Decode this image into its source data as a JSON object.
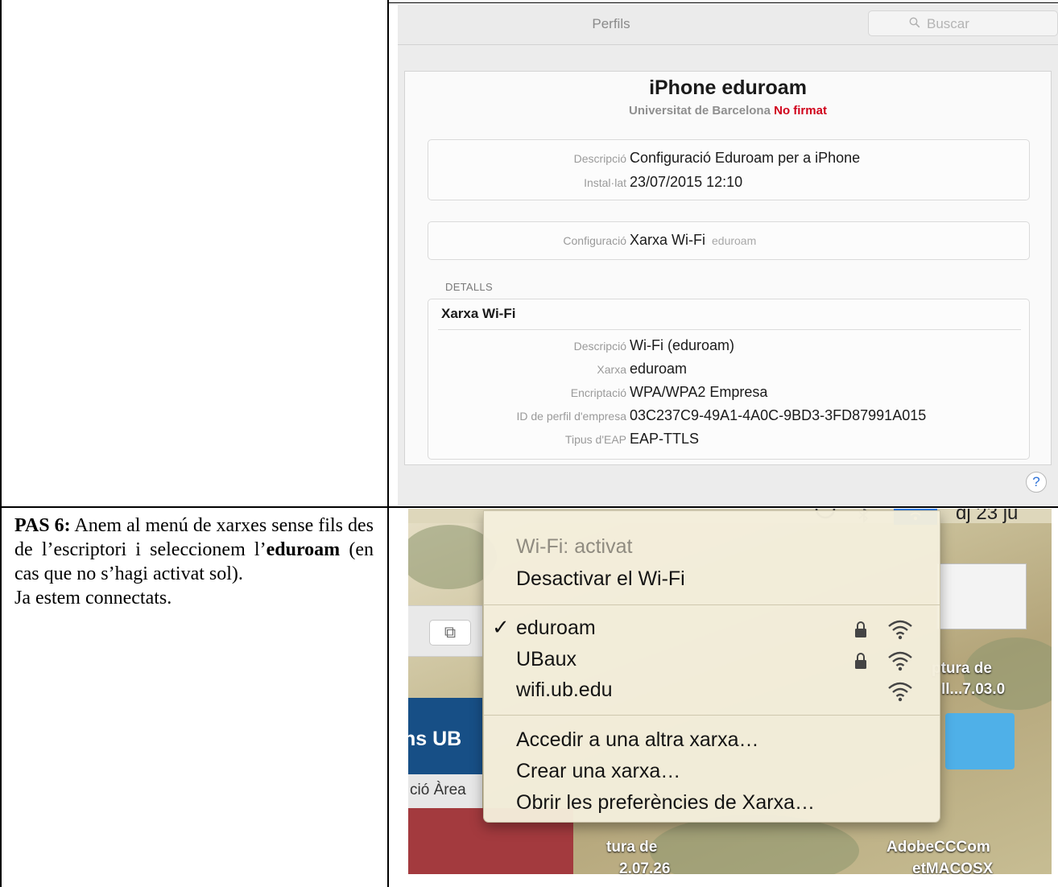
{
  "step": {
    "label": "PAS 6:",
    "text_before": " Anem al menú de xarxes sense fils des de l’escriptori i seleccionem l’",
    "highlight": "eduroam",
    "text_after": " (en cas que no s’hagi activat sol).",
    "line2": "Ja estem connectats."
  },
  "profiles_window": {
    "title": "Perfils",
    "search_placeholder": "Buscar",
    "profile_name": "iPhone eduroam",
    "organization": "Universitat de Barcelona",
    "signed_status": "No firmat",
    "summary": [
      {
        "key": "Descripció",
        "value": "Configuració Eduroam per a iPhone"
      },
      {
        "key": "Instal·lat",
        "value": "23/07/2015 12:10"
      }
    ],
    "configuration": {
      "key": "Configuració",
      "value": "Xarxa Wi-Fi",
      "extra": "eduroam"
    },
    "details_label": "DETALLS",
    "details_title": "Xarxa Wi-Fi",
    "details": [
      {
        "key": "Descripció",
        "value": "Wi-Fi (eduroam)"
      },
      {
        "key": "Xarxa",
        "value": "eduroam"
      },
      {
        "key": "Encriptació",
        "value": "WPA/WPA2 Empresa"
      },
      {
        "key": "ID de perfil d'empresa",
        "value": "03C237C9-49A1-4A0C-9BD3-3FD87991A015"
      },
      {
        "key": "Tipus d'EAP",
        "value": "EAP-TTLS"
      }
    ],
    "help": "?",
    "accent_color": "#d0021b"
  },
  "wifi_menu": {
    "clock": "dj 23 ju",
    "status": "Wi-Fi: activat",
    "toggle": "Desactivar el Wi-Fi",
    "networks": [
      {
        "name": "eduroam",
        "checked": true,
        "locked": true
      },
      {
        "name": "UBaux",
        "checked": false,
        "locked": true
      },
      {
        "name": "wifi.ub.edu",
        "checked": false,
        "locked": false
      }
    ],
    "checkmark": "✓",
    "actions": [
      "Accedir a una altra xarxa…",
      "Crear una xarxa…",
      "Obrir les preferències de Xarxa…"
    ],
    "desktop": {
      "tab_glyph": "⧉",
      "ub_text": "ns UB",
      "area_text": "ció Àrea",
      "label_captura_1": "ptura de",
      "label_captura_2": "ll...7.03.0",
      "label_bottom_1": "tura de",
      "label_bottom_2": "AdobeCCCom",
      "label_bottom_3": "2.07.26",
      "label_bottom_4": "etMACOSX"
    },
    "highlight_color": "#2f7be6"
  }
}
